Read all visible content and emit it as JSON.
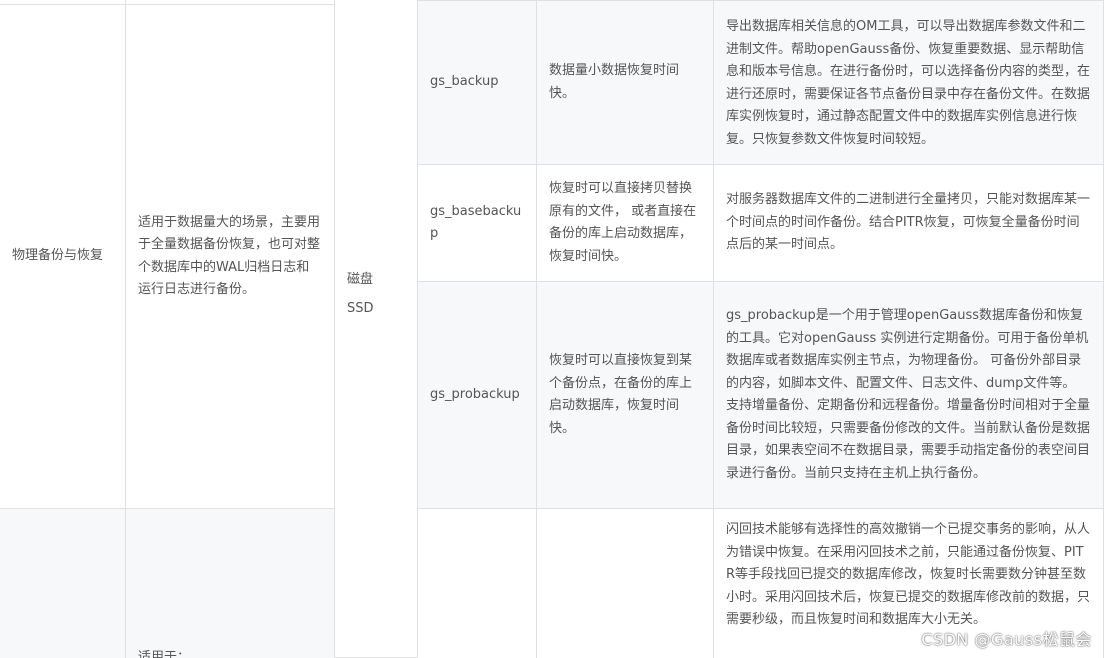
{
  "table": {
    "group1": {
      "category": "物理备份与恢复",
      "scenario": "适用于数据量大的场景，主要用于全量数据备份恢复，也可对整个数据库中的WAL归档日志和运行日志进行备份。",
      "medium": [
        "磁盘",
        "SSD"
      ],
      "rows": [
        {
          "tool": "gs_backup",
          "feature": "数据量小数据恢复时间快。",
          "description": "导出数据库相关信息的OM工具，可以导出数据库参数文件和二进制文件。帮助openGauss备份、恢复重要数据、显示帮助信息和版本号信息。在进行备份时，可以选择备份内容的类型，在进行还原时，需要保证各节点备份目录中存在备份文件。在数据库实例恢复时，通过静态配置文件中的数据库实例信息进行恢复。只恢复参数文件恢复时间较短。"
        },
        {
          "tool": "gs_basebackup",
          "feature": "恢复时可以直接拷贝替换原有的文件， 或者直接在备份的库上启动数据库，恢复时间快。",
          "description": "对服务器数据库文件的二进制进行全量拷贝，只能对数据库某一个时间点的时间作备份。结合PITR恢复，可恢复全量备份时间点后的某一时间点。"
        },
        {
          "tool": "gs_probackup",
          "feature": "恢复时可以直接恢复到某个备份点，在备份的库上启动数据库，恢复时间快。",
          "description": "gs_probackup是一个用于管理openGauss数据库备份和恢复的工具。它对openGauss 实例进行定期备份。可用于备份单机数据库或者数据库实例主节点，为物理备份。 可备份外部目录的内容，如脚本文件、配置文件、日志文件、dump文件等。 支持增量备份、定期备份和远程备份。增量备份时间相对于全量备份时间比较短，只需要备份修改的文件。当前默认备份是数据目录，如果表空间不在数据目录，需要手动指定备份的表空间目录进行备份。当前只支持在主机上执行备份。"
        }
      ]
    },
    "group2": {
      "scenario_partial": "适用于：",
      "description": "闪回技术能够有选择性的高效撤销一个已提交事务的影响，从人为错误中恢复。在采用闪回技术之前，只能通过备份恢复、PITR等手段找回已提交的数据库修改，恢复时长需要数分钟甚至数小时。采用闪回技术后，恢复已提交的数据库修改前的数据，只需要秒级，而且恢复时间和数据库大小无关。"
    }
  },
  "watermark": "CSDN @Gauss松鼠会",
  "colors": {
    "border": "#e0e0e0",
    "shaded_row": "#f7f8fa",
    "text": "#555555"
  }
}
